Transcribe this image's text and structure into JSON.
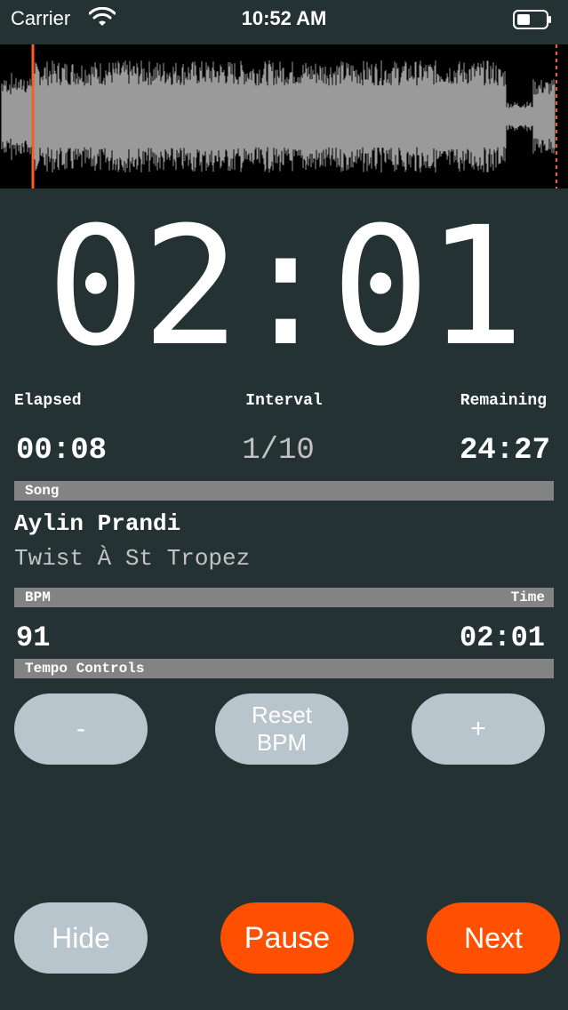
{
  "status_bar": {
    "carrier": "Carrier",
    "time": "10:52 AM"
  },
  "waveform": {
    "playhead_fraction": 0.058
  },
  "timer": {
    "display": "02:01"
  },
  "stats": {
    "elapsed_label": "Elapsed",
    "elapsed_value": "00:08",
    "interval_label": "Interval",
    "interval_value": "1/10",
    "remaining_label": "Remaining",
    "remaining_value": "24:27"
  },
  "song_section": {
    "header": "Song",
    "artist": "Aylin Prandi",
    "title": "Twist À St Tropez"
  },
  "bpm_section": {
    "header_left": "BPM",
    "header_right": "Time",
    "bpm_value": "91",
    "time_value": "02:01"
  },
  "tempo_section": {
    "header": "Tempo Controls",
    "minus_label": "-",
    "reset_label": "Reset BPM",
    "plus_label": "+"
  },
  "bottom_controls": {
    "hide_label": "Hide",
    "pause_label": "Pause",
    "next_label": "Next"
  },
  "colors": {
    "background": "#243234",
    "accent_orange": "#ff4f00",
    "button_grey": "#b8c5cc",
    "section_bar": "#838383",
    "playhead": "#ff5a1f"
  }
}
